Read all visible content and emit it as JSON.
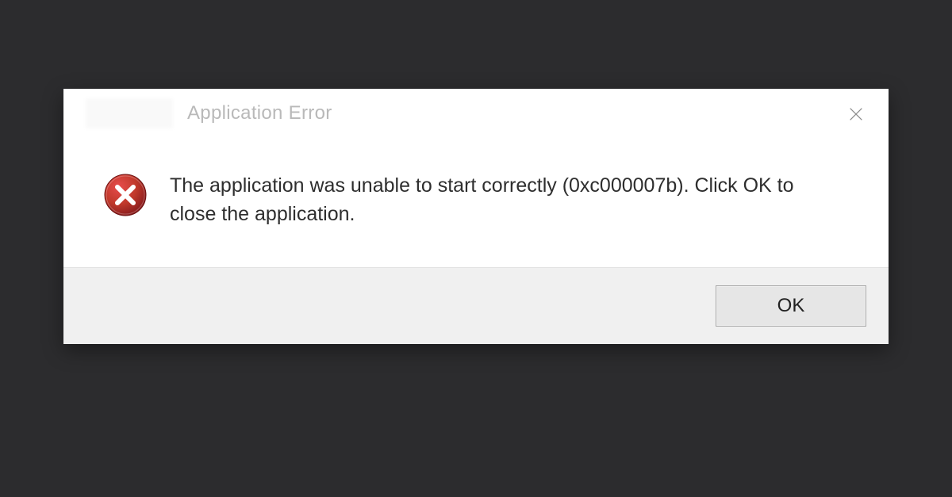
{
  "dialog": {
    "title": "Application Error",
    "message": "The application was unable to start correctly (0xc000007b). Click OK to close the application.",
    "icon": "error-cross-icon",
    "buttons": {
      "ok_label": "OK"
    }
  }
}
